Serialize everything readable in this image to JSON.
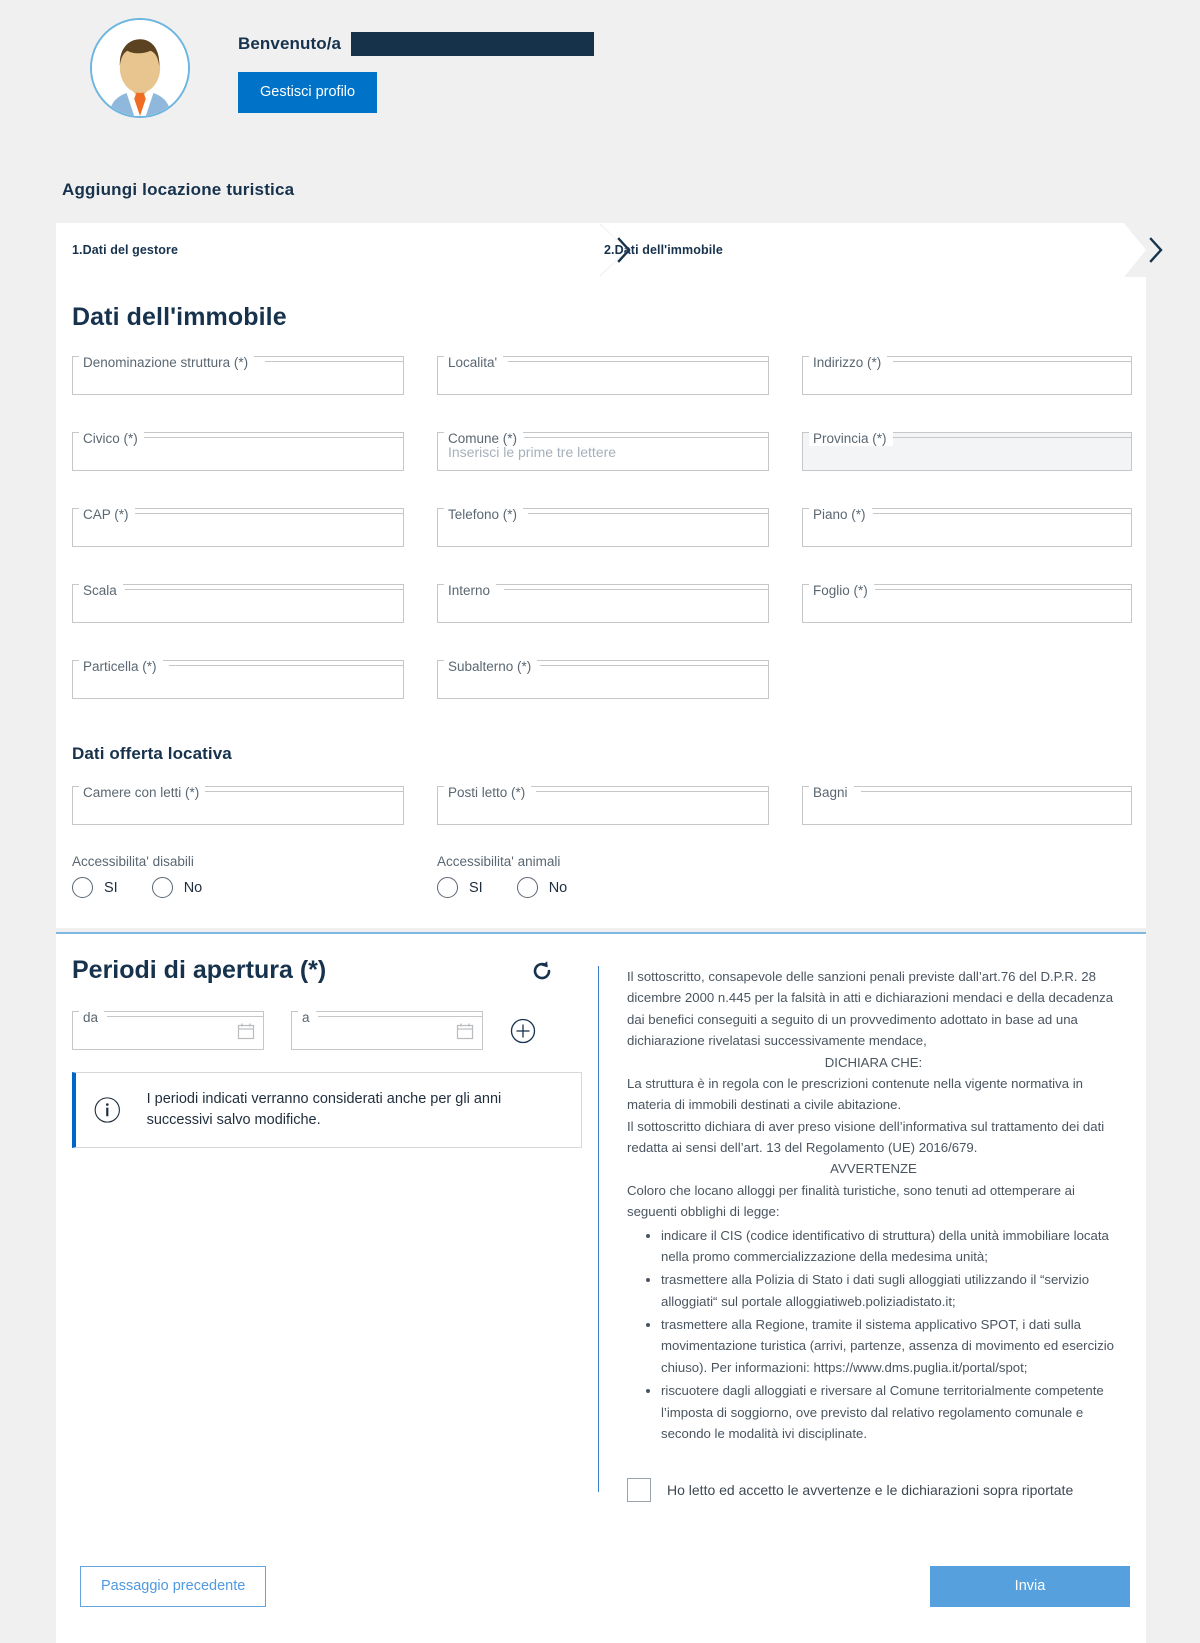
{
  "header": {
    "welcome_label": "Benvenuto/a",
    "redacted_name": "",
    "manage_profile_button": "Gestisci profilo",
    "avatar_alt": "avatar-illustration"
  },
  "page": {
    "title": "Aggiungi locazione turistica"
  },
  "stepper": {
    "steps": [
      {
        "label": "1.Dati del gestore"
      },
      {
        "label": "2.Dati dell'immobile"
      }
    ]
  },
  "immobile": {
    "section_title": "Dati dell'immobile",
    "fields": [
      {
        "label": "Denominazione struttura (*)",
        "value": "",
        "placeholder": "",
        "disabled": false
      },
      {
        "label": "Localita'",
        "value": "",
        "placeholder": "",
        "disabled": false
      },
      {
        "label": "Indirizzo (*)",
        "value": "",
        "placeholder": "",
        "disabled": false
      },
      {
        "label": "Civico (*)",
        "value": "",
        "placeholder": "",
        "disabled": false
      },
      {
        "label": "Comune (*)",
        "value": "",
        "placeholder": "Inserisci le prime tre lettere",
        "disabled": false
      },
      {
        "label": "Provincia (*)",
        "value": "",
        "placeholder": "",
        "disabled": true
      },
      {
        "label": "CAP (*)",
        "value": "",
        "placeholder": "",
        "disabled": false
      },
      {
        "label": "Telefono (*)",
        "value": "",
        "placeholder": "",
        "disabled": false
      },
      {
        "label": "Piano (*)",
        "value": "",
        "placeholder": "",
        "disabled": false
      },
      {
        "label": "Scala",
        "value": "",
        "placeholder": "",
        "disabled": false
      },
      {
        "label": "Interno",
        "value": "",
        "placeholder": "",
        "disabled": false
      },
      {
        "label": "Foglio (*)",
        "value": "",
        "placeholder": "",
        "disabled": false
      },
      {
        "label": "Particella (*)",
        "value": "",
        "placeholder": "",
        "disabled": false
      },
      {
        "label": "Subalterno (*)",
        "value": "",
        "placeholder": "",
        "disabled": false
      }
    ]
  },
  "offerta": {
    "section_title": "Dati offerta locativa",
    "fields": [
      {
        "label": "Camere con letti (*)",
        "value": "",
        "placeholder": "",
        "disabled": false
      },
      {
        "label": "Posti letto (*)",
        "value": "",
        "placeholder": "",
        "disabled": false
      },
      {
        "label": "Bagni",
        "value": "",
        "placeholder": "",
        "disabled": false
      }
    ],
    "radios": [
      {
        "caption": "Accessibilita' disabili",
        "yes": "SI",
        "no": "No"
      },
      {
        "caption": "Accessibilita' animali",
        "yes": "SI",
        "no": "No"
      }
    ]
  },
  "periodi": {
    "title": "Periodi di apertura (*)",
    "refresh_icon": "refresh-icon",
    "add_icon": "plus-circle-icon",
    "from_label": "da",
    "to_label": "a",
    "from_value": "",
    "to_value": "",
    "calendar_icon": "calendar-icon",
    "info_icon": "info-circle-icon",
    "info_text": "I periodi indicati verranno considerati anche per gli anni successivi salvo modifiche."
  },
  "declaration": {
    "intro": "Il sottoscritto, consapevole delle sanzioni penali previste dall’art.76 del D.P.R. 28 dicembre 2000 n.445 per la falsità in atti e dichiarazioni mendaci e della decadenza dai benefici conseguiti a seguito di un provvedimento adottato in base ad una dichiarazione rivelatasi successivamente mendace,",
    "dichiara_heading": "DICHIARA CHE:",
    "dichiara_1": "La struttura è in regola con le prescrizioni contenute nella vigente normativa in materia di immobili destinati a civile abitazione.",
    "dichiara_2": "Il sottoscritto dichiara di aver preso visione dell’informativa sul trattamento dei dati redatta ai sensi dell’art. 13 del Regolamento (UE) 2016/679.",
    "avvertenze_heading": "AVVERTENZE",
    "avvertenze_intro": "Coloro che locano alloggi per finalità turistiche, sono tenuti ad ottemperare ai seguenti obblighi di legge:",
    "bullets": [
      "indicare il CIS (codice identificativo di struttura) della unità immobiliare locata nella promo commercializzazione della medesima unità;",
      "trasmettere alla Polizia di Stato i dati sugli alloggiati utilizzando il “servizio alloggiati“ sul portale alloggiatiweb.poliziadistato.it;",
      "trasmettere alla Regione, tramite il sistema applicativo SPOT, i dati sulla movimentazione turistica (arrivi, partenze, assenza di movimento ed esercizio chiuso). Per informazioni: https://www.dms.puglia.it/portal/spot;",
      "riscuotere dagli alloggiati e riversare al Comune territorialmente competente l’imposta di soggiorno, ove previsto dal relativo regolamento comunale e secondo le modalità ivi disciplinate."
    ],
    "accept_label": "Ho letto ed accetto le avvertenze e le dichiarazioni sopra riportate"
  },
  "footer": {
    "prev_button": "Passaggio precedente",
    "send_button": "Invia"
  },
  "colors": {
    "brand_blue": "#0073c8",
    "accent_blue": "#56a0dd",
    "navy": "#17324d",
    "page_bg": "#f0f0f0",
    "border_grey": "#c5c7c9",
    "disabled_bg": "#f3f4f5"
  }
}
